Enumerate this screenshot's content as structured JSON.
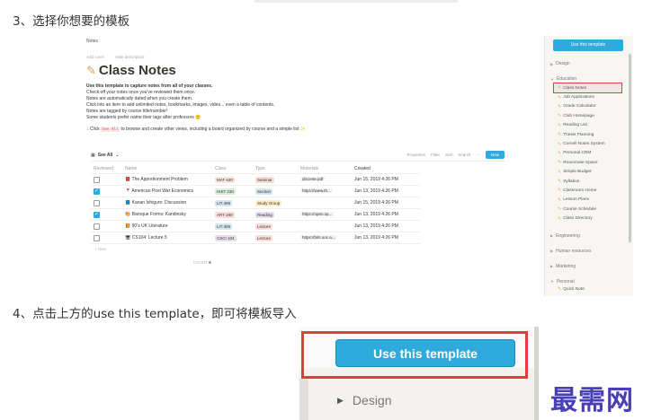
{
  "step3": "3、选择你想要的模板",
  "step4": "4、点击上方的use this template，即可将模板导入",
  "watermark": "最需网",
  "notion": {
    "breadcrumb": "Notes",
    "add_cover": "Add cover",
    "hide_description": "Hide description",
    "title": "Class Notes",
    "title_icon": "pencil-icon",
    "desc_lead": "Use this template to capture notes from all of your classes.",
    "desc_lines": [
      "Check off your notes once you've reviewed them once.",
      "Notes are automatically dated when you create them.",
      "Click into an item to add unlimited notes, bookmarks, images, video... even a table of contents.",
      "Notes are tagged by course title/number!",
      "Some students prefer name their tags after professors 🙂"
    ],
    "tip_prefix": "↓ Click",
    "tip_code": "See All",
    "tip_suffix": "to browse and create other views, including a board organized by course and a simple list ✨",
    "view_label": "See All",
    "tools": [
      "Properties",
      "Filter",
      "Sort",
      "Search",
      "···"
    ],
    "new_label": "New",
    "columns": [
      "Reviewed",
      "Name",
      "Class",
      "Type",
      "Materials",
      "Created"
    ],
    "rows": [
      {
        "checked": false,
        "icon": "📕",
        "name": "The Apportionment Problem",
        "class": "MAT 630",
        "class_color": "#fbe4d9",
        "type": "Seminar",
        "type_color": "#fadedb",
        "material": "discrete.pdf",
        "created": "Jun 15, 2019 4:26 PM"
      },
      {
        "checked": true,
        "icon": "📍",
        "name": "American Post War Economics",
        "class": "HIST 230",
        "class_color": "#dbeddb",
        "type": "Section",
        "type_color": "#d3e5ef",
        "material": "https://www.th...",
        "created": "Jun 13, 2019 4:26 PM"
      },
      {
        "checked": false,
        "icon": "📘",
        "name": "Kanan Ishiguro: Discussion",
        "class": "LIT 495",
        "class_color": "#d3e5ef",
        "type": "Study Group",
        "type_color": "#fdecc8",
        "material": "",
        "created": "Jun 15, 2019 4:26 PM"
      },
      {
        "checked": true,
        "icon": "🎨",
        "name": "Baroque Forms: Kandinsky",
        "class": "ART 289",
        "class_color": "#fadedb",
        "type": "Reading",
        "type_color": "#e8deee",
        "material": "https://open.sp...",
        "created": "Jun 13, 2019 4:26 PM"
      },
      {
        "checked": false,
        "icon": "📙",
        "name": "90's UK Literature",
        "class": "LIT 455",
        "class_color": "#d3e5ef",
        "type": "Lecture",
        "type_color": "#fadedb",
        "material": "",
        "created": "Jun 13, 2019 4:26 PM"
      },
      {
        "checked": false,
        "icon": "🖥",
        "name": "CS104: Lecture 5",
        "class": "CSCI 104",
        "class_color": "#e8deee",
        "type": "Lecture",
        "type_color": "#fadedb",
        "material": "https://bits.uoc.a...",
        "created": "Jun 13, 2019 4:26 PM"
      }
    ],
    "new_row": "+ New",
    "count_label": "COUNT",
    "count_value": "6"
  },
  "sidebar": {
    "use_template": "Use this template",
    "group_design": "Design",
    "group_education": "Education",
    "education_items": [
      {
        "label": "Class Notes",
        "active": true
      },
      {
        "label": "Job Applications",
        "active": false
      },
      {
        "label": "Grade Calculator",
        "active": false
      },
      {
        "label": "Club Homepage",
        "active": false
      },
      {
        "label": "Reading List",
        "active": false
      },
      {
        "label": "Thesis Planning",
        "active": false
      },
      {
        "label": "Cornell Notes System",
        "active": false
      },
      {
        "label": "Personal CRM",
        "active": false
      },
      {
        "label": "Roommate Space",
        "active": false
      },
      {
        "label": "Simple Budget",
        "active": false
      },
      {
        "label": "Syllabus",
        "active": false
      },
      {
        "label": "Classroom Home",
        "active": false
      },
      {
        "label": "Lesson Plans",
        "active": false
      },
      {
        "label": "Course Schedule",
        "active": false
      },
      {
        "label": "Class Directory",
        "active": false
      }
    ],
    "group_engineering": "Engineering",
    "group_hr": "Human resources",
    "group_marketing": "Marketing",
    "group_personal": "Personal",
    "personal_item": "Quick Note"
  },
  "zoom": {
    "use_template": "Use this template",
    "design": "Design"
  }
}
